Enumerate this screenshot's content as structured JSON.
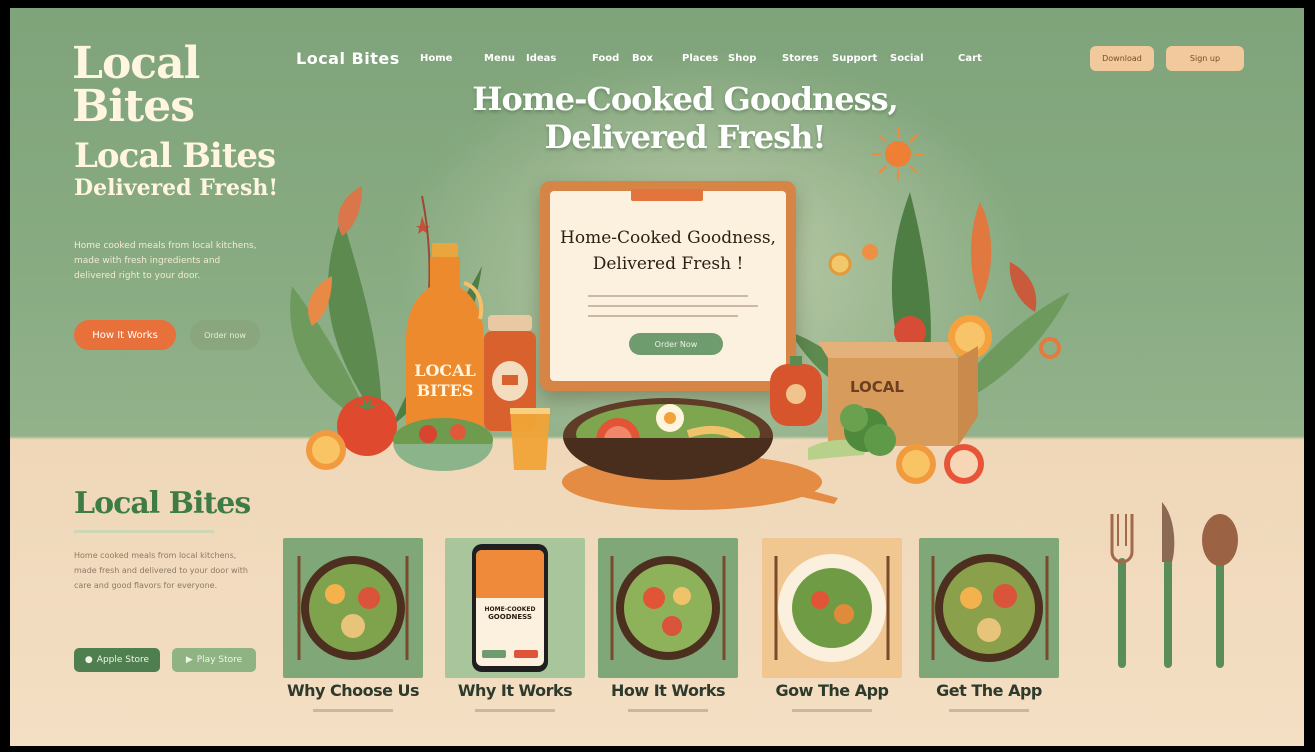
{
  "brand": {
    "logo_line1": "Local",
    "logo_line2": "Bites",
    "title": "Local Bites",
    "subtitle": "Delivered Fresh!"
  },
  "hero": {
    "headline_line1": "Home-Cooked Goodness,",
    "headline_line2": "Delivered Fresh!",
    "description": "Home cooked meals from local kitchens, made with fresh ingredients and delivered right to your door.",
    "primary_button": "How It Works",
    "secondary_button": "Order now"
  },
  "nav": {
    "brand": "Local Bites",
    "items": [
      "Home",
      "Menu",
      "Ideas",
      "Food",
      "Box",
      "Places",
      "Shop",
      "Stores",
      "Support",
      "Social",
      "Cart"
    ],
    "button_1": "Download",
    "button_2": "Sign up"
  },
  "tablet": {
    "headline_line1": "Home-Cooked Goodness,",
    "headline_line2": "Delivered Fresh !",
    "button": "Order Now"
  },
  "props": {
    "bottle_label_1": "LOCAL",
    "bottle_label_2": "BITES",
    "box_label": "LOCAL"
  },
  "section": {
    "title": "Local Bites",
    "description": "Home cooked meals from local kitchens, made fresh and delivered to your door with care and good flavors for everyone.",
    "store_button_1": "Apple Store",
    "store_button_2": "Play Store"
  },
  "cards": [
    {
      "label": "Why Choose Us"
    },
    {
      "label": "Why It Works",
      "phone_text_1": "HOME-COOKED",
      "phone_text_2": "GOODNESS"
    },
    {
      "label": "How It Works"
    },
    {
      "label": "Gow The App"
    },
    {
      "label": "Get The App"
    }
  ],
  "colors": {
    "accent_orange": "#e8703a",
    "brand_green": "#3f7c45",
    "background_green": "#88ab82",
    "background_cream": "#f4dfc4"
  }
}
